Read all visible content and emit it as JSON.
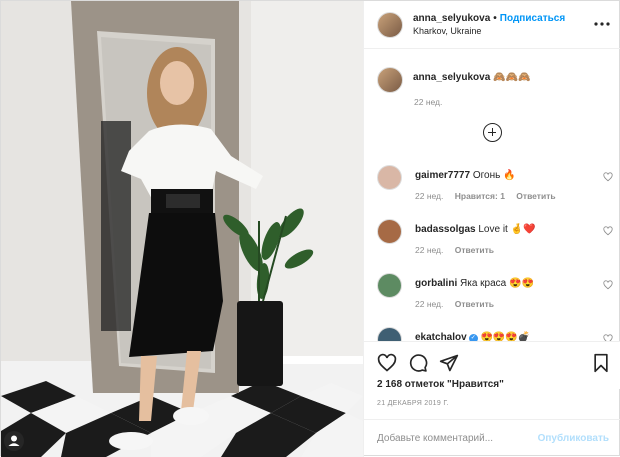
{
  "post": {
    "username": "anna_selyukova",
    "dot": "•",
    "follow_label": "Подписаться",
    "location": "Kharkov, Ukraine",
    "more_icon": "more-horizontal-icon",
    "caption_text": "🙈🙈🙈",
    "caption_time": "22 нед."
  },
  "comments": [
    {
      "username": "gaimer7777",
      "text": "Огонь 🔥",
      "time": "22 нед.",
      "likes_label": "Нравится: 1",
      "reply_label": "Ответить",
      "avatar_color": "#d9b7a6"
    },
    {
      "username": "badassolgas",
      "text": "Love it 🤞❤️",
      "time": "22 нед.",
      "likes_label": "",
      "reply_label": "Ответить",
      "avatar_color": "#a66a45"
    },
    {
      "username": "gorbalini",
      "text": "Яка краса 😍😍",
      "time": "22 нед.",
      "likes_label": "",
      "reply_label": "Ответить",
      "avatar_color": "#5d8b62"
    },
    {
      "username": "ekatchalov",
      "text": "😍😍😍💣",
      "time": "",
      "likes_label": "",
      "reply_label": "",
      "avatar_color": "#3f5f73"
    }
  ],
  "actions": {
    "like_icon": "heart-icon",
    "comment_icon": "comment-icon",
    "share_icon": "share-icon",
    "save_icon": "bookmark-icon"
  },
  "likes_text": "2 168 отметок \"Нравится\"",
  "date_text": "21 ДЕКАБРЯ 2019 Г.",
  "add_comment": {
    "placeholder": "Добавьте комментарий...",
    "publish_label": "Опубликовать"
  },
  "colors": {
    "accent": "#0095f6",
    "publish_disabled": "#b2dffc",
    "muted": "#8e8e8e"
  }
}
